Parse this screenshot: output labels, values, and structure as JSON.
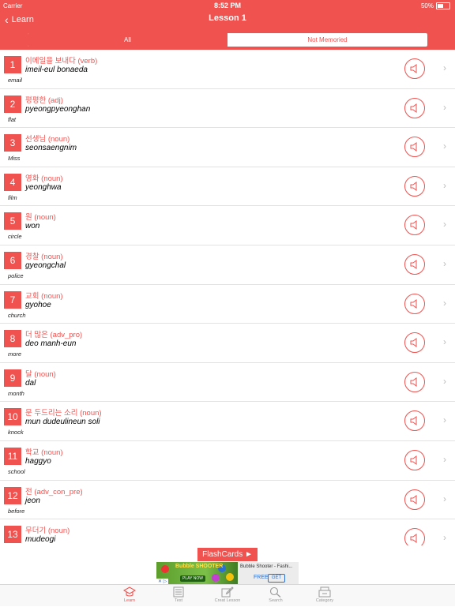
{
  "status": {
    "carrier": "Carrier",
    "time": "8:52 PM",
    "battery": "50%"
  },
  "nav": {
    "back_label": "Learn",
    "title": "Lesson 1"
  },
  "segments": {
    "all": "All",
    "not_memoried": "Not Memoried",
    "selected": "All"
  },
  "words": [
    {
      "n": "1",
      "korean": "이메일을 보내다 (verb)",
      "romanization": "imeil-eul bonaeda",
      "english": "email"
    },
    {
      "n": "2",
      "korean": "평평한 (adj)",
      "romanization": "pyeongpyeonghan",
      "english": "flat"
    },
    {
      "n": "3",
      "korean": "선생님 (noun)",
      "romanization": "seonsaengnim",
      "english": "Miss"
    },
    {
      "n": "4",
      "korean": "영화 (noun)",
      "romanization": "yeonghwa",
      "english": "film"
    },
    {
      "n": "5",
      "korean": "원 (noun)",
      "romanization": "won",
      "english": "circle"
    },
    {
      "n": "6",
      "korean": "경찰 (noun)",
      "romanization": "gyeongchal",
      "english": "police"
    },
    {
      "n": "7",
      "korean": "교회 (noun)",
      "romanization": "gyohoe",
      "english": "church"
    },
    {
      "n": "8",
      "korean": "더 많은 (adv_pro)",
      "romanization": "deo manh-eun",
      "english": "more"
    },
    {
      "n": "9",
      "korean": "달 (noun)",
      "romanization": "dal",
      "english": "month"
    },
    {
      "n": "10",
      "korean": "문 두드리는 소리 (noun)",
      "romanization": "mun dudeulineun soli",
      "english": "knock"
    },
    {
      "n": "11",
      "korean": "학교 (noun)",
      "romanization": "haggyo",
      "english": "school"
    },
    {
      "n": "12",
      "korean": "전 (adv_con_pre)",
      "romanization": "jeon",
      "english": "before"
    },
    {
      "n": "13",
      "korean": "무더기 (noun)",
      "romanization": "mudeogi",
      "english": ""
    }
  ],
  "flashcards_label": "FlashCards ►",
  "ad": {
    "logo": "Bubble SHOOTER",
    "play_now": "PLAY NOW",
    "title": "Bubble Shooter - Fashi...",
    "free": "FREE",
    "get": "GET"
  },
  "tabs": [
    {
      "label": "Learn",
      "icon": "learn-icon"
    },
    {
      "label": "Test",
      "icon": "test-icon"
    },
    {
      "label": "Creat Lesson",
      "icon": "create-lesson-icon"
    },
    {
      "label": "Search",
      "icon": "search-icon"
    },
    {
      "label": "Category",
      "icon": "category-icon"
    }
  ],
  "colors": {
    "accent": "#f0524f",
    "tab_inactive": "#9a9a9a"
  }
}
